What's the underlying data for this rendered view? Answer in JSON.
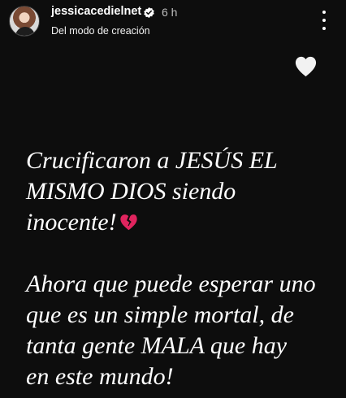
{
  "header": {
    "username": "jessicacedielnet",
    "time": "6 h",
    "subtitle": "Del modo de creación"
  },
  "story": {
    "paragraph1": {
      "line1": "Crucificaron a JESÚS EL",
      "line2": "MISMO DIOS siendo",
      "line3": "inocente!"
    },
    "paragraph2": {
      "line1": "Ahora que puede esperar uno",
      "line2": "que es un simple mortal, de",
      "line3": "tanta gente MALA que hay",
      "line4": "en este mundo!"
    },
    "emoji": "broken-heart-icon"
  },
  "icons": {
    "verified": "verified-badge-icon",
    "more": "more-options-icon",
    "like": "white-heart-icon"
  },
  "colors": {
    "background": "#0d0d0d",
    "text": "#ffffff",
    "broken_heart": "#e0245e",
    "verified": "#3897f0"
  }
}
